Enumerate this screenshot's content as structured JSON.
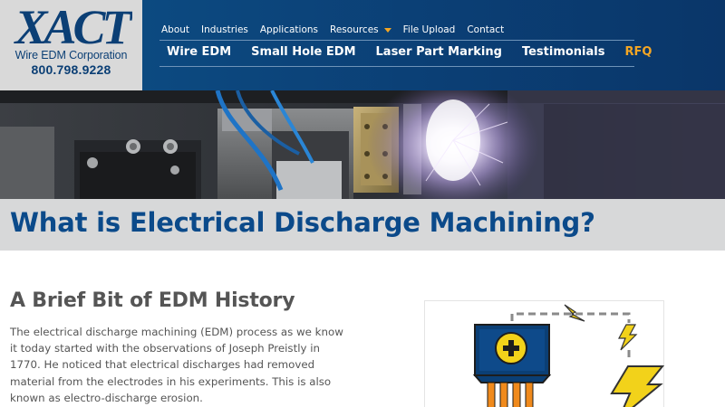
{
  "brand": {
    "logo_text": "XACT",
    "company": "Wire EDM Corporation",
    "phone": "800.798.9228",
    "primary_color": "#0b3f75",
    "accent_color": "#f5a623"
  },
  "top_nav": {
    "items": [
      "About",
      "Industries",
      "Applications",
      "Resources",
      "File Upload",
      "Contact"
    ]
  },
  "main_nav": {
    "items": [
      "Wire EDM",
      "Small Hole EDM",
      "Laser Part Marking",
      "Testimonials",
      "RFQ"
    ]
  },
  "hero": {
    "image": "edm-machining-spark-photo"
  },
  "page": {
    "title": "What is Electrical Discharge Machining?"
  },
  "content": {
    "heading": "A Brief Bit of EDM History",
    "paragraph": "The electrical discharge machining (EDM) process as we know it today started with the observations of Joseph Preistly in 1770. He noticed that electrical discharges had removed material from the electrodes in his experiments. This is also known as electro-discharge erosion."
  },
  "diagram": {
    "icons": [
      "plus-electrode-icon",
      "lightning-bolt-icon",
      "spark-icon"
    ]
  }
}
